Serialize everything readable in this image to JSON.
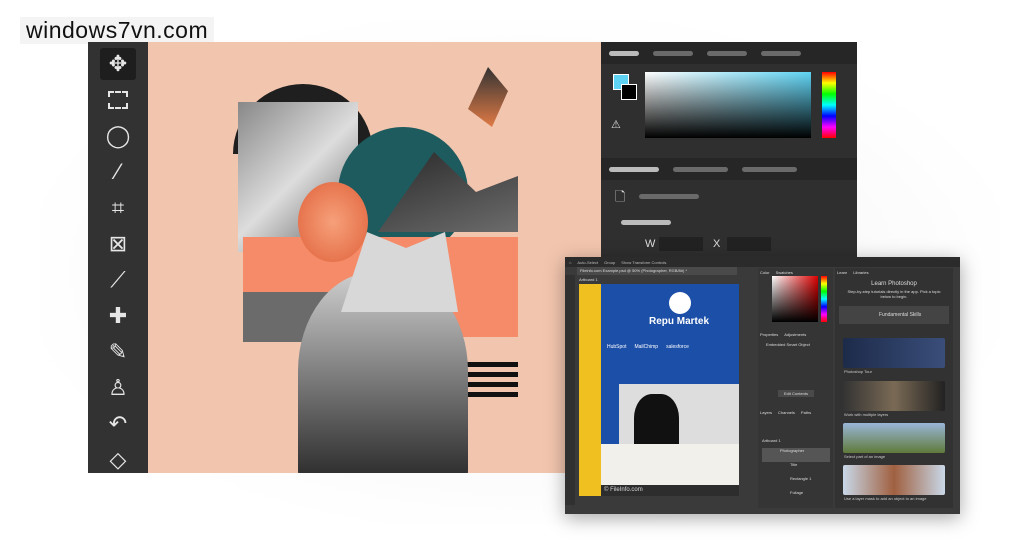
{
  "watermark": "windows7vn.com",
  "toolbar": {
    "tools": [
      "move-tool",
      "marquee-tool",
      "lasso-tool",
      "magic-wand-tool",
      "crop-tool",
      "frame-tool",
      "eyedropper-tool",
      "healing-brush-tool",
      "brush-tool",
      "clone-stamp-tool",
      "history-brush-tool",
      "eraser-tool"
    ]
  },
  "properties": {
    "w_label": "W",
    "x_label": "X"
  },
  "small_window": {
    "doc_tab": "Fileinfo.com Example.psd @ 50% (Photographer, RGB/8#) *",
    "artboard": "Artboard 1",
    "top_buttons": [
      "Auto-Select",
      "Group",
      "Show Transform Controls"
    ],
    "artwork": {
      "brand": "Repu Martek",
      "partners": [
        "HubSpot",
        "MailChimp",
        "salesforce"
      ],
      "credit": "© FileInfo.com"
    },
    "color_tabs": [
      "Color",
      "Swatches"
    ],
    "properties_tabs": [
      "Properties",
      "Adjustments"
    ],
    "smart_object": "Embedded Smart Object",
    "edit_contents": "Edit Contents",
    "layers_tabs": [
      "Layers",
      "Channels",
      "Paths"
    ],
    "layers": [
      "Artboard 1",
      "Photographer",
      "Title",
      "Rectangle 1",
      "Foliage"
    ],
    "learn_tabs": [
      "Learn",
      "Libraries"
    ],
    "learn_title": "Learn Photoshop",
    "learn_desc": "Step-by-step tutorials directly in the app. Pick a topic below to begin.",
    "topic": "Fundamental Skills",
    "tutorials": [
      "Photoshop Tour",
      "Work with multiple layers",
      "Select part of an image",
      "Use a layer mask to add an object to an image"
    ]
  }
}
